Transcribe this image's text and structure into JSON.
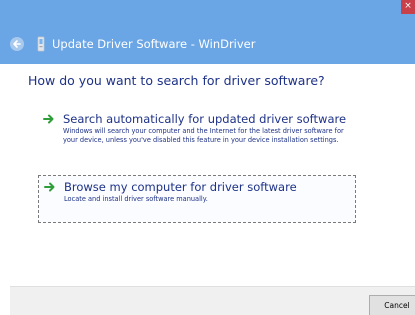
{
  "window": {
    "close_label": "×",
    "title": "Update Driver Software - WinDriver",
    "back_icon": "back-arrow-icon",
    "wizard_icon": "device-icon",
    "accent_color": "#6aa5e6",
    "close_color": "#c7404a"
  },
  "main": {
    "question": "How do you want to search for driver software?",
    "options": [
      {
        "title": "Search automatically for updated driver software",
        "description": "Windows will search your computer and the Internet for the latest driver software for your device, unless you've disabled this feature in your device installation settings.",
        "icon": "green-arrow-icon"
      },
      {
        "title": "Browse my computer for driver software",
        "description": "Locate and install driver software manually.",
        "icon": "green-arrow-icon"
      }
    ],
    "text_color": "#1e3287",
    "arrow_color": "#2f9e3a"
  },
  "footer": {
    "cancel_label": "Cancel"
  }
}
